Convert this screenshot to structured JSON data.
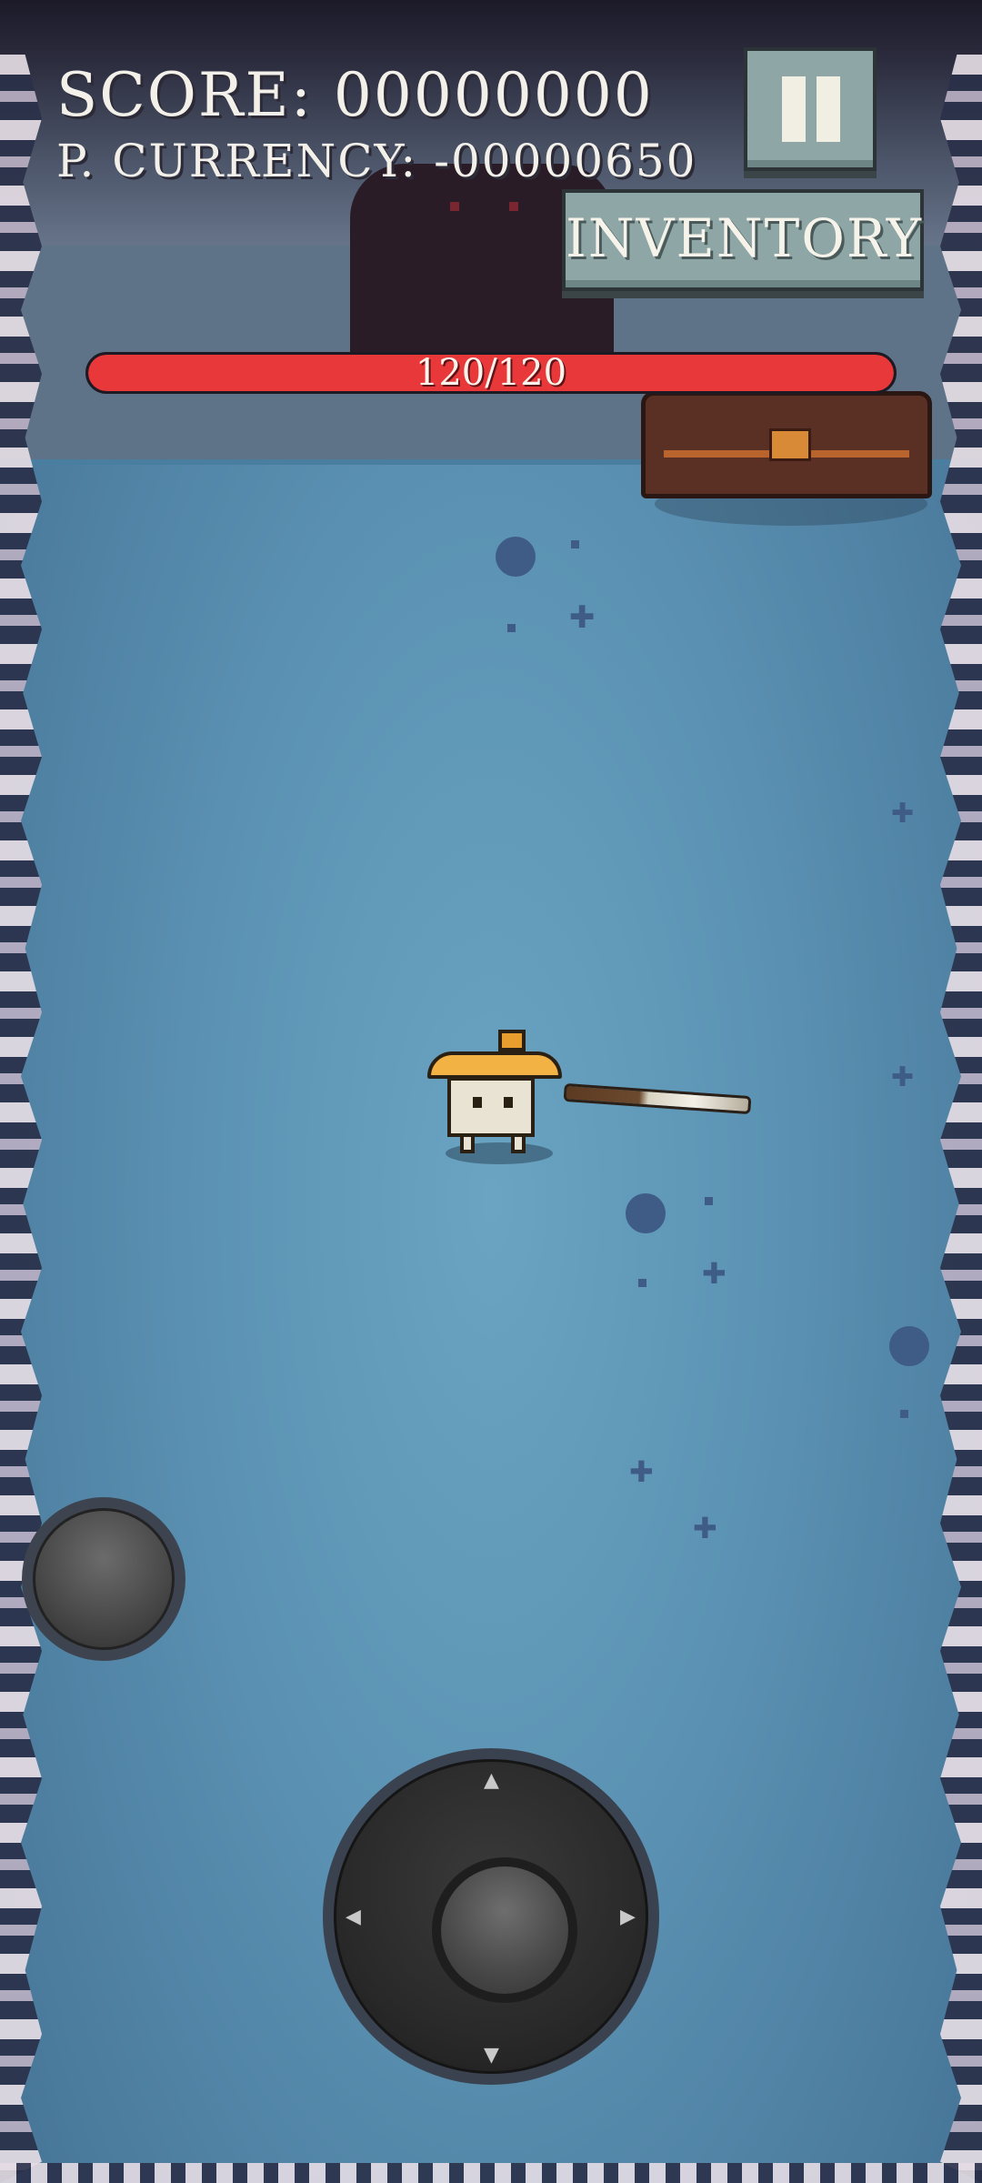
{
  "hud": {
    "score_text": "SCORE: 00000000",
    "currency_text": "P. CURRENCY: -00000650",
    "pause_icon": "pause-icon",
    "inventory_label": "INVENTORY"
  },
  "health": {
    "current": 120,
    "max": 120,
    "label": "120/120",
    "fill_fraction": 1.0,
    "color": "#e8383a"
  },
  "controls": {
    "attack_button_icon": "circle-button",
    "joystick_arrows": [
      "▲",
      "▶",
      "▼",
      "◀"
    ]
  },
  "sprites": {
    "player": "straw-hat-character",
    "weapon": "sword",
    "enemy": "chest-boss"
  },
  "colors": {
    "floor": "#5c93b4",
    "hud_button": "#8ea6a6",
    "text": "#f3f0ea"
  }
}
